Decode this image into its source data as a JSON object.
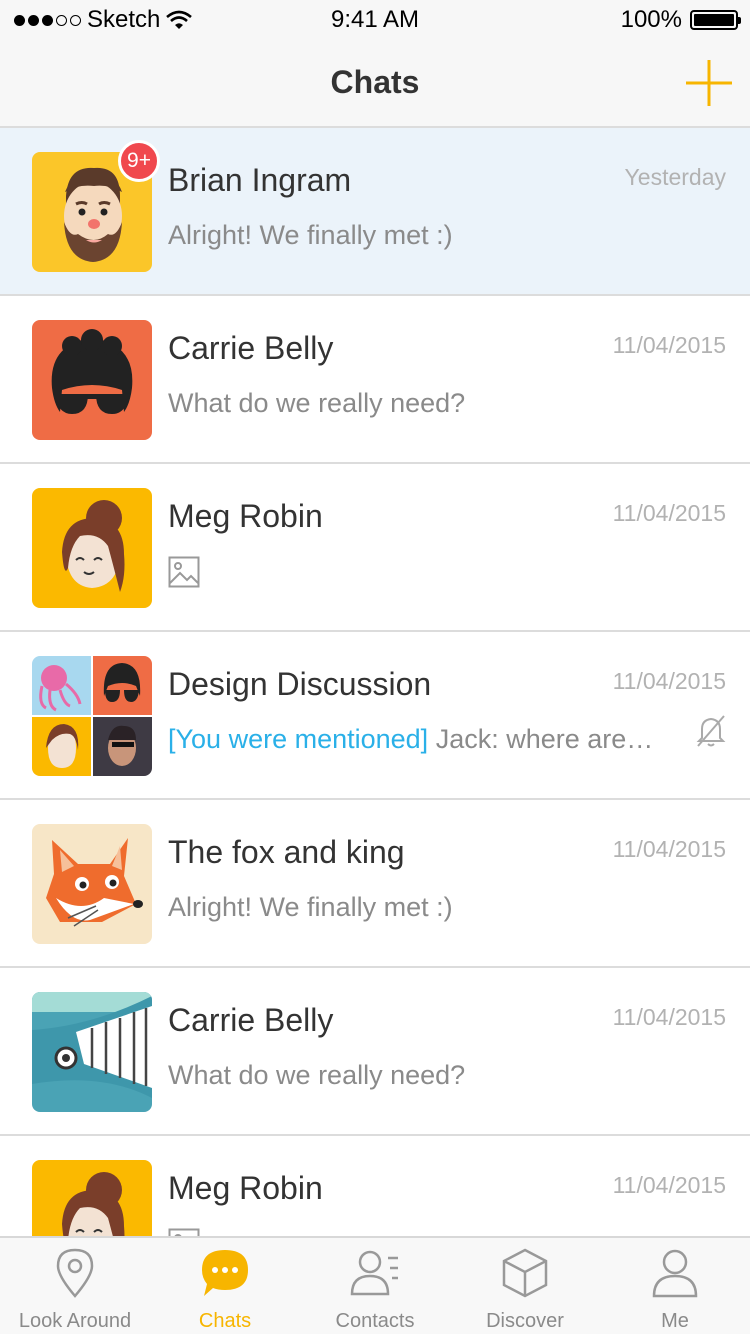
{
  "status_bar": {
    "carrier": "Sketch",
    "time": "9:41 AM",
    "battery": "100%"
  },
  "nav": {
    "title": "Chats"
  },
  "chats": [
    {
      "name": "Brian Ingram",
      "time": "Yesterday",
      "preview": "Alright! We finally met :)",
      "badge": "9+"
    },
    {
      "name": "Carrie Belly",
      "time": "11/04/2015",
      "preview": "What do we really need?"
    },
    {
      "name": "Meg Robin",
      "time": "11/04/2015",
      "preview_icon": "image-icon"
    },
    {
      "name": "Design Discussion",
      "time": "11/04/2015",
      "mention": "[You were mentioned]",
      "preview": " Jack: where are…",
      "status_icon": "mute-icon"
    },
    {
      "name": "The fox and king",
      "time": "11/04/2015",
      "preview": "Alright! We finally met :)"
    },
    {
      "name": "Carrie Belly",
      "time": "11/04/2015",
      "preview": "What do we really need?"
    },
    {
      "name": "Meg Robin",
      "time": "11/04/2015",
      "preview_icon": "image-icon"
    }
  ],
  "tabs": [
    {
      "label": "Look Around",
      "icon": "location-pin-icon"
    },
    {
      "label": "Chats",
      "icon": "chat-bubble-icon",
      "active": true
    },
    {
      "label": "Contacts",
      "icon": "contacts-icon"
    },
    {
      "label": "Discover",
      "icon": "cube-icon"
    },
    {
      "label": "Me",
      "icon": "person-icon"
    }
  ],
  "colors": {
    "accent": "#f7b500",
    "badge": "#f0484e",
    "mention": "#2ab0e8",
    "highlight_row": "#ebf3fa"
  }
}
